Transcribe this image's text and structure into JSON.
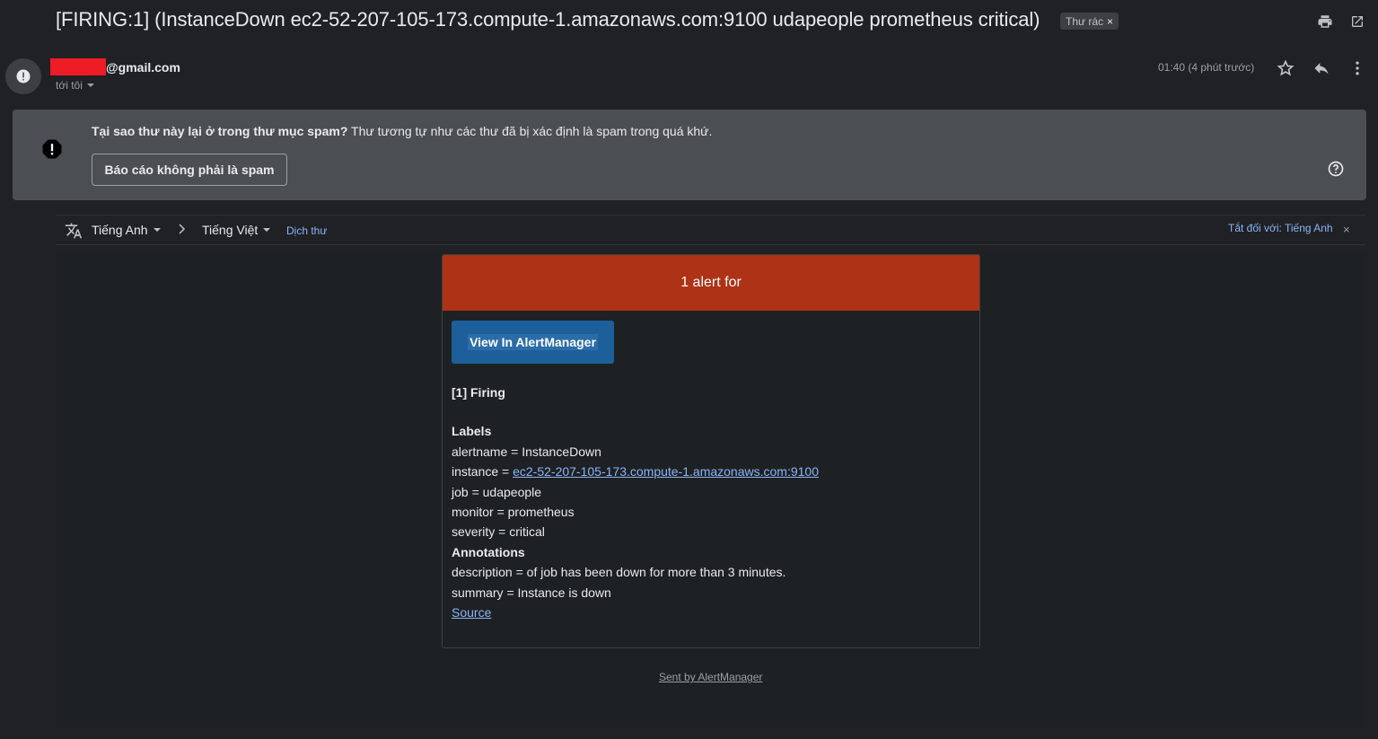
{
  "email": {
    "subject": "[FIRING:1] (InstanceDown ec2-52-207-105-173.compute-1.amazonaws.com:9100 udapeople prometheus critical)",
    "label_chip": "Thư rác",
    "label_chip_close": "×",
    "sender_email": "@gmail.com",
    "to_me": "tới tôi",
    "time": "01:40 (4 phút trước)",
    "icons": {
      "print": "print-icon",
      "open_new_window": "open-in-new-window-icon",
      "avatar": "alert-avatar-icon",
      "star": "star-icon",
      "reply": "reply-icon",
      "more": "more-vertical-icon"
    }
  },
  "spam_warning": {
    "question": "Tại sao thư này lại ở trong thư mục spam?",
    "explanation": "Thư tương tự như các thư đã bị xác định là spam trong quá khứ.",
    "report_button": "Báo cáo không phải là spam"
  },
  "translate_bar": {
    "source_lang": "Tiếng Anh",
    "target_lang": "Tiếng Việt",
    "translate_link": "Dịch thư",
    "turn_off_link": "Tắt đối với: Tiếng Anh",
    "close": "×"
  },
  "alert": {
    "header": "1 alert for",
    "view_button": "View In AlertManager",
    "firing": "[1] Firing",
    "labels_heading": "Labels",
    "labels": {
      "alertname": "alertname = InstanceDown",
      "instance_prefix": "instance = ",
      "instance_link": "ec2-52-207-105-173.compute-1.amazonaws.com:9100",
      "job": "job = udapeople",
      "monitor": "monitor = prometheus",
      "severity": "severity = critical"
    },
    "annotations_heading": "Annotations",
    "annotations": {
      "description": "description = of job has been down for more than 3 minutes.",
      "summary": "summary = Instance is down"
    },
    "source_link": "Source",
    "footer": "Sent by AlertManager"
  },
  "colors": {
    "background": "#202124",
    "spam_box": "#4b4f54",
    "alert_header": "#ae3215",
    "view_button": "#1c5f9a",
    "link": "#8ab4f8"
  }
}
